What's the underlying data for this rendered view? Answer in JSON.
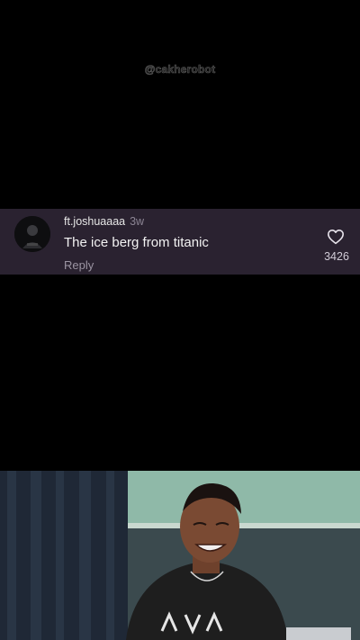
{
  "watermark": "@cakherobot",
  "comment": {
    "username": "ft.joshuaaaa",
    "age": "3w",
    "text": "The ice berg from titanic",
    "reply_label": "Reply",
    "like_count": "3426",
    "avatar_icon": "profile-photo",
    "like_icon": "heart-outline-icon"
  },
  "colors": {
    "background": "#000000",
    "comment_bg": "#2a2230",
    "username": "#e6e6e6",
    "secondary_text": "#9b94a2"
  }
}
